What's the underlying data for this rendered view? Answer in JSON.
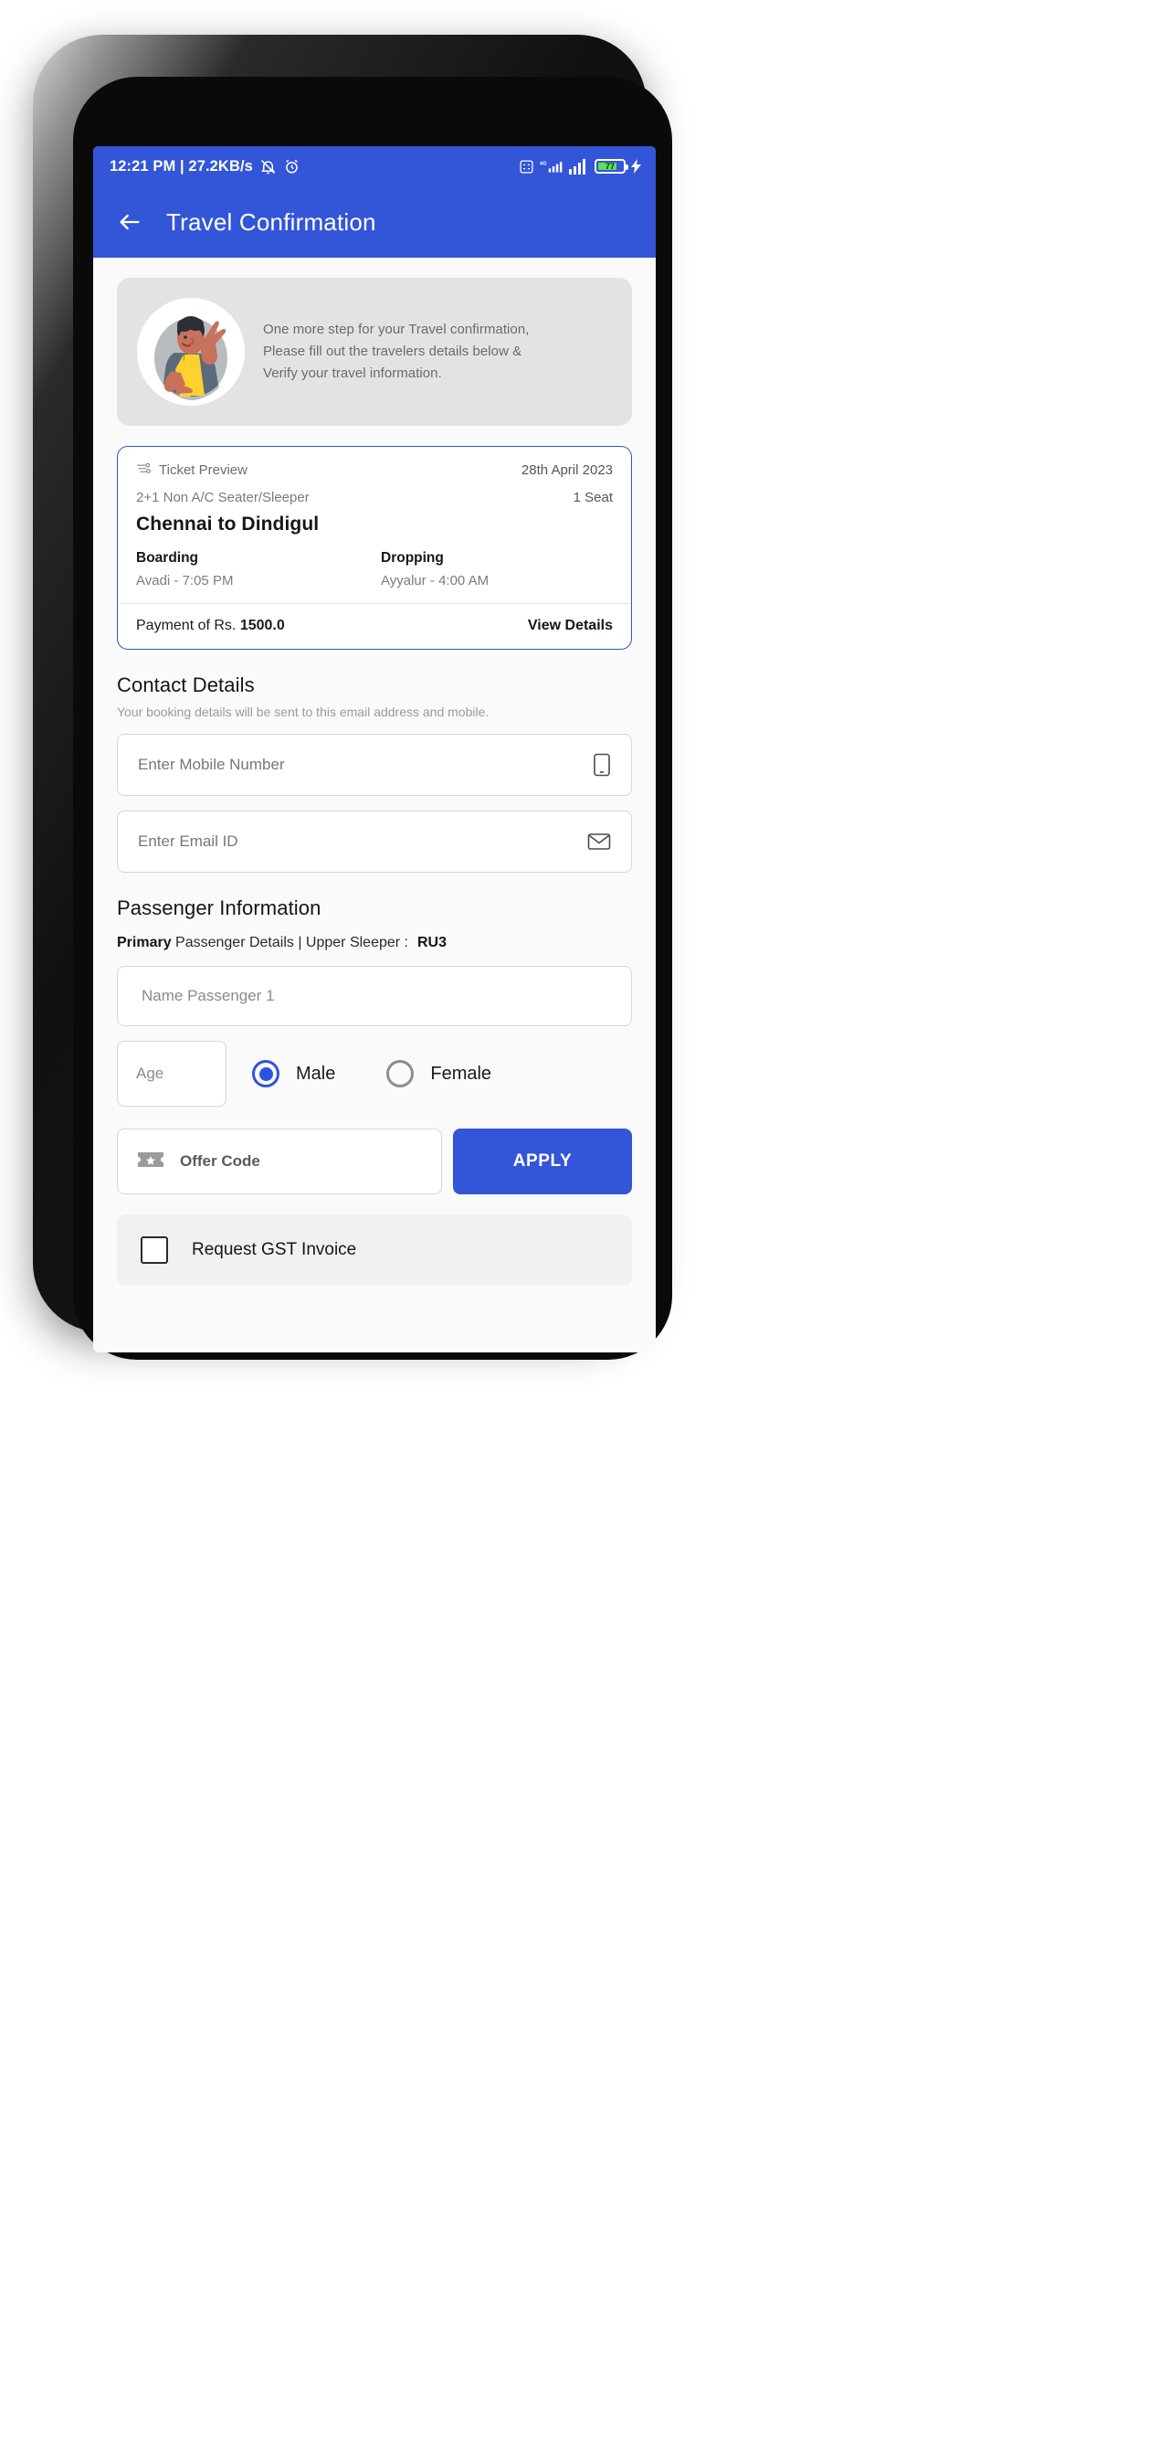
{
  "status_bar": {
    "time_and_net": "12:21 PM | 27.2KB/s",
    "mute_icon": "bell-muted-icon",
    "alarm_icon": "alarm-clock-icon",
    "network_type": "4G",
    "battery_percent": "77"
  },
  "app_bar": {
    "back_icon": "back-arrow-icon",
    "title": "Travel Confirmation"
  },
  "banner": {
    "illustration": "waving-person-illustration",
    "line1": "One more step for your Travel confirmation,",
    "line2": "Please fill out the travelers details below &",
    "line3": "Verify your travel information."
  },
  "ticket": {
    "preview_icon": "ticket-icon",
    "preview_label": "Ticket Preview",
    "date": "28th April 2023",
    "bus_type": "2+1 Non A/C Seater/Sleeper",
    "seat_count": "1 Seat",
    "route": "Chennai to Dindigul",
    "boarding_label": "Boarding",
    "boarding_value": "Avadi - 7:05 PM",
    "dropping_label": "Dropping",
    "dropping_value": "Ayyalur - 4:00 AM",
    "payment_prefix": "Payment of Rs. ",
    "payment_amount": "1500.0",
    "view_details": "View Details"
  },
  "contact": {
    "title": "Contact Details",
    "subtitle": "Your booking details will be sent to this email address and mobile.",
    "mobile_placeholder": "Enter Mobile Number",
    "mobile_icon": "phone-icon",
    "email_placeholder": "Enter Email ID",
    "email_icon": "envelope-icon"
  },
  "passenger": {
    "title": "Passenger Information",
    "primary_label": "Primary",
    "details_text": " Passenger Details | Upper Sleeper :",
    "seat_number": "RU3",
    "name_placeholder": "Name Passenger 1",
    "age_placeholder": "Age",
    "male_label": "Male",
    "female_label": "Female",
    "selected_gender": "Male"
  },
  "offer": {
    "icon": "offer-ticket-icon",
    "placeholder": "Offer Code",
    "apply_label": "APPLY"
  },
  "gst": {
    "checkbox_icon": "checkbox-unchecked-icon",
    "label": "Request GST Invoice"
  },
  "colors": {
    "primary": "#3355d8",
    "accent": "#2f53e0",
    "banner_bg": "#e3e3e3"
  }
}
